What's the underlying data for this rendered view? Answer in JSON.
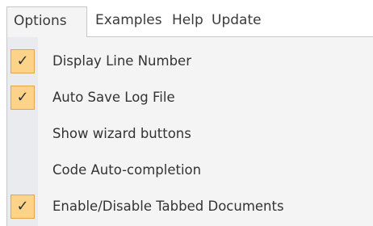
{
  "menubar": {
    "items": [
      {
        "label": "Options"
      },
      {
        "label": "Examples"
      },
      {
        "label": "Help"
      },
      {
        "label": "Update"
      }
    ]
  },
  "dropdown": {
    "items": [
      {
        "label": "Display Line Number",
        "checked": true,
        "check_glyph": "✓"
      },
      {
        "label": "Auto Save Log File",
        "checked": true,
        "check_glyph": "✓"
      },
      {
        "label": "Show wizard buttons",
        "checked": false
      },
      {
        "label": "Code Auto-completion",
        "checked": false
      },
      {
        "label": "Enable/Disable Tabbed Documents",
        "checked": true,
        "check_glyph": "✓"
      }
    ]
  },
  "colors": {
    "check_fill": "#fdd38a",
    "check_border": "#e8a44b",
    "menu_bg": "#f4f4f4",
    "gutter_bg": "#e9ebef"
  }
}
